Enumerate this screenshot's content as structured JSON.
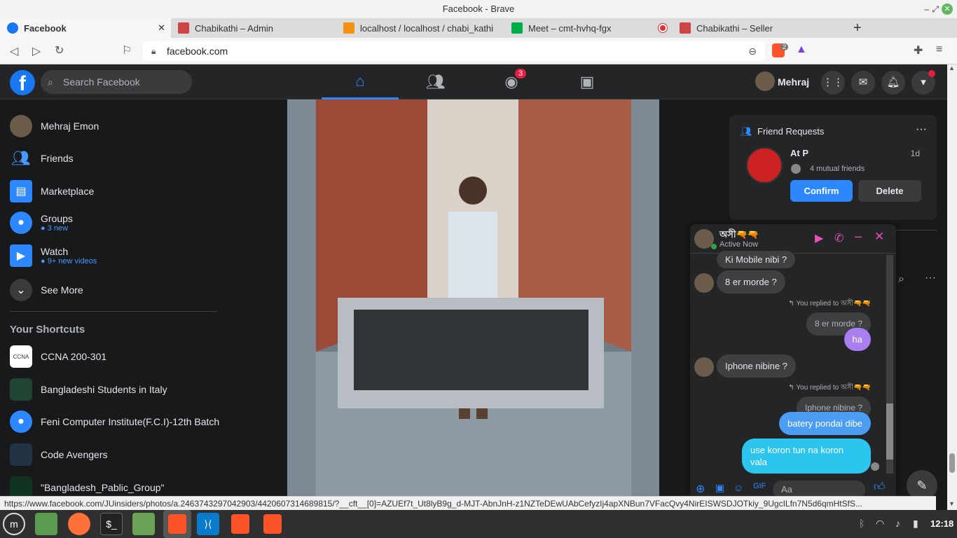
{
  "window": {
    "title": "Facebook - Brave"
  },
  "tabs": [
    {
      "label": "Facebook",
      "active": true
    },
    {
      "label": "Chabikathi – Admin"
    },
    {
      "label": "localhost / localhost / chabi_kathi"
    },
    {
      "label": "Meet – cmt-hvhq-fgx"
    },
    {
      "label": "Chabikathi – Seller"
    }
  ],
  "toolbar": {
    "url": "facebook.com",
    "brave_badge": "2"
  },
  "header": {
    "search_placeholder": "Search Facebook",
    "groups_badge": "3",
    "profile_name": "Mehraj"
  },
  "sidebar": {
    "profile": "Mehraj Emon",
    "items": [
      {
        "label": "Friends"
      },
      {
        "label": "Marketplace"
      },
      {
        "label": "Groups",
        "sub": "3 new"
      },
      {
        "label": "Watch",
        "sub": "9+ new videos"
      },
      {
        "label": "See More"
      }
    ],
    "shortcuts_title": "Your Shortcuts",
    "shortcuts": [
      {
        "label": "CCNA 200-301"
      },
      {
        "label": "Bangladeshi Students in Italy"
      },
      {
        "label": "Feni Computer Institute(F.C.I)-12th Batch"
      },
      {
        "label": "Code Avengers"
      },
      {
        "label": "\"Bangladesh_Pablic_Group\""
      }
    ]
  },
  "friend_requests": {
    "title": "Friend Requests",
    "name": "At P",
    "time": "1d",
    "mutual": "4 mutual friends",
    "confirm": "Confirm",
    "delete": "Delete"
  },
  "chat": {
    "name": "অসী🔫🔫",
    "status": "Active Now",
    "messages": {
      "m1": "Ki Mobile nibi ?",
      "m2": "8 er morde ?",
      "reply_note1": "You replied to অসী🔫🔫",
      "reply_quote1": "8 er morde ?",
      "m3": "ha",
      "m4": "Iphone nibine ?",
      "reply_note2": "You replied to অসী🔫🔫",
      "reply_quote2": "Iphone nibine ?",
      "m5": "batery pondai dibe",
      "m6": "use koron tun na koron vala"
    },
    "input_placeholder": "Aa"
  },
  "status_url": "https://www.facebook.com/JUinsiders/photos/a.2463743297042903/4420607314689815/?__cft__[0]=AZUEf7t_Ut8lyB9g_d-MJT-AbnJnH-z1NZTeDEwUAbCefyzIj4apXNBun7VFacQvy4NirEISWSDJOTkiy_9UgcILfn7N5d6qmHtSfS...",
  "taskbar": {
    "clock": "12:18"
  },
  "colors": {
    "fb_blue": "#1877f2",
    "chat_bubble": "#2bc5ee",
    "dark_bg": "#18191a",
    "card_bg": "#242526"
  }
}
